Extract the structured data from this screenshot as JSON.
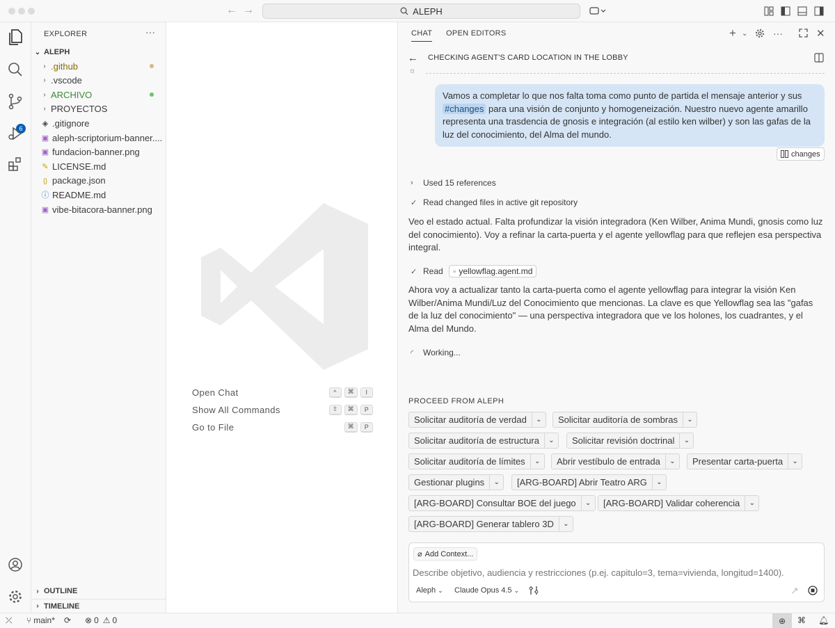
{
  "titlebar": {
    "search_text": "ALEPH"
  },
  "activity": {
    "scm_badge": "6"
  },
  "explorer": {
    "title": "EXPLORER",
    "root": "ALEPH",
    "items": [
      {
        "label": ".github",
        "icon": "chevron-right",
        "color": "#8b6b00",
        "dot": "#d8b58a"
      },
      {
        "label": ".vscode",
        "icon": "chevron-right",
        "color": "#3b3b3b",
        "dot": ""
      },
      {
        "label": "ARCHIVO",
        "icon": "chevron-right",
        "color": "#388a34",
        "dot": "#6cc36c"
      },
      {
        "label": "PROYECTOS",
        "icon": "chevron-right",
        "color": "#3b3b3b",
        "dot": ""
      },
      {
        "label": ".gitignore",
        "icon": "git-icon",
        "color": "#3b3b3b",
        "dot": ""
      },
      {
        "label": "aleph-scriptorium-banner....",
        "icon": "image-icon",
        "color": "#3b3b3b",
        "dot": ""
      },
      {
        "label": "fundacion-banner.png",
        "icon": "image-icon",
        "color": "#3b3b3b",
        "dot": ""
      },
      {
        "label": "LICENSE.md",
        "icon": "license-icon",
        "color": "#3b3b3b",
        "dot": ""
      },
      {
        "label": "package.json",
        "icon": "json-icon",
        "color": "#3b3b3b",
        "dot": ""
      },
      {
        "label": "README.md",
        "icon": "info-icon",
        "color": "#3b3b3b",
        "dot": ""
      },
      {
        "label": "vibe-bitacora-banner.png",
        "icon": "image-icon",
        "color": "#3b3b3b",
        "dot": ""
      }
    ],
    "outline": "OUTLINE",
    "timeline": "TIMELINE"
  },
  "editor": {
    "shortcuts": [
      {
        "label": "Open Chat",
        "keys": [
          "^",
          "⌘",
          "I"
        ]
      },
      {
        "label": "Show All Commands",
        "keys": [
          "⇧",
          "⌘",
          "P"
        ]
      },
      {
        "label": "Go to File",
        "keys": [
          "⌘",
          "P"
        ]
      }
    ]
  },
  "chat": {
    "tab_chat": "CHAT",
    "tab_open_editors": "OPEN EDITORS",
    "session_title": "CHECKING AGENT'S CARD LOCATION IN THE LOBBY",
    "user_message_pre": "Vamos a completar lo que nos falta toma como punto de partida el mensaje anterior y sus",
    "user_message_hash": "#changes",
    "user_message_post": "para una visión de conjunto y homogeneización. Nuestro nuevo agente amarillo representa una trasdencia de gnosis e integración (al estilo ken wilber) y son las gafas de la luz del conocimiento, del Alma del mundo.",
    "changes_chip": "changes",
    "used_refs": "Used 15 references",
    "read_changed": "Read changed files in active git repository",
    "para1": "Veo el estado actual. Falta profundizar la visión integradora (Ken Wilber, Anima Mundi, gnosis como luz del conocimiento). Voy a refinar la carta-puerta y el agente yellowflag para que reflejen esa perspectiva integral.",
    "read_label": "Read",
    "read_file": "yellowflag.agent.md",
    "para2": "Ahora voy a actualizar tanto la carta-puerta como el agente yellowflag para integrar la visión Ken Wilber/Anima Mundi/Luz del Conocimiento que mencionas. La clave es que Yellowflag sea las \"gafas de la luz del conocimiento\" — una perspectiva integradora que ve los holones, los cuadrantes, y el Alma del Mundo.",
    "working": "Working...",
    "proceed_title": "PROCEED FROM ALEPH",
    "proceed": [
      "Solicitar auditoría de verdad",
      "Solicitar auditoría de sombras",
      "Solicitar auditoría de estructura",
      "Solicitar revisión doctrinal",
      "Solicitar auditoría de límites",
      "Abrir vestíbulo de entrada",
      "Presentar carta-puerta",
      "Gestionar plugins",
      "[ARG-BOARD] Abrir Teatro ARG",
      "[ARG-BOARD] Consultar BOE del juego",
      "[ARG-BOARD] Validar coherencia",
      "[ARG-BOARD] Generar tablero 3D"
    ],
    "add_context": "Add Context...",
    "input_placeholder": "Describe objetivo, audiencia y restricciones (p.ej. capitulo=3, tema=vivienda, longitud=1400).",
    "agent_select": "Aleph",
    "model_select": "Claude Opus 4.5"
  },
  "status": {
    "branch": "main*",
    "errors": "0",
    "warnings": "0"
  }
}
